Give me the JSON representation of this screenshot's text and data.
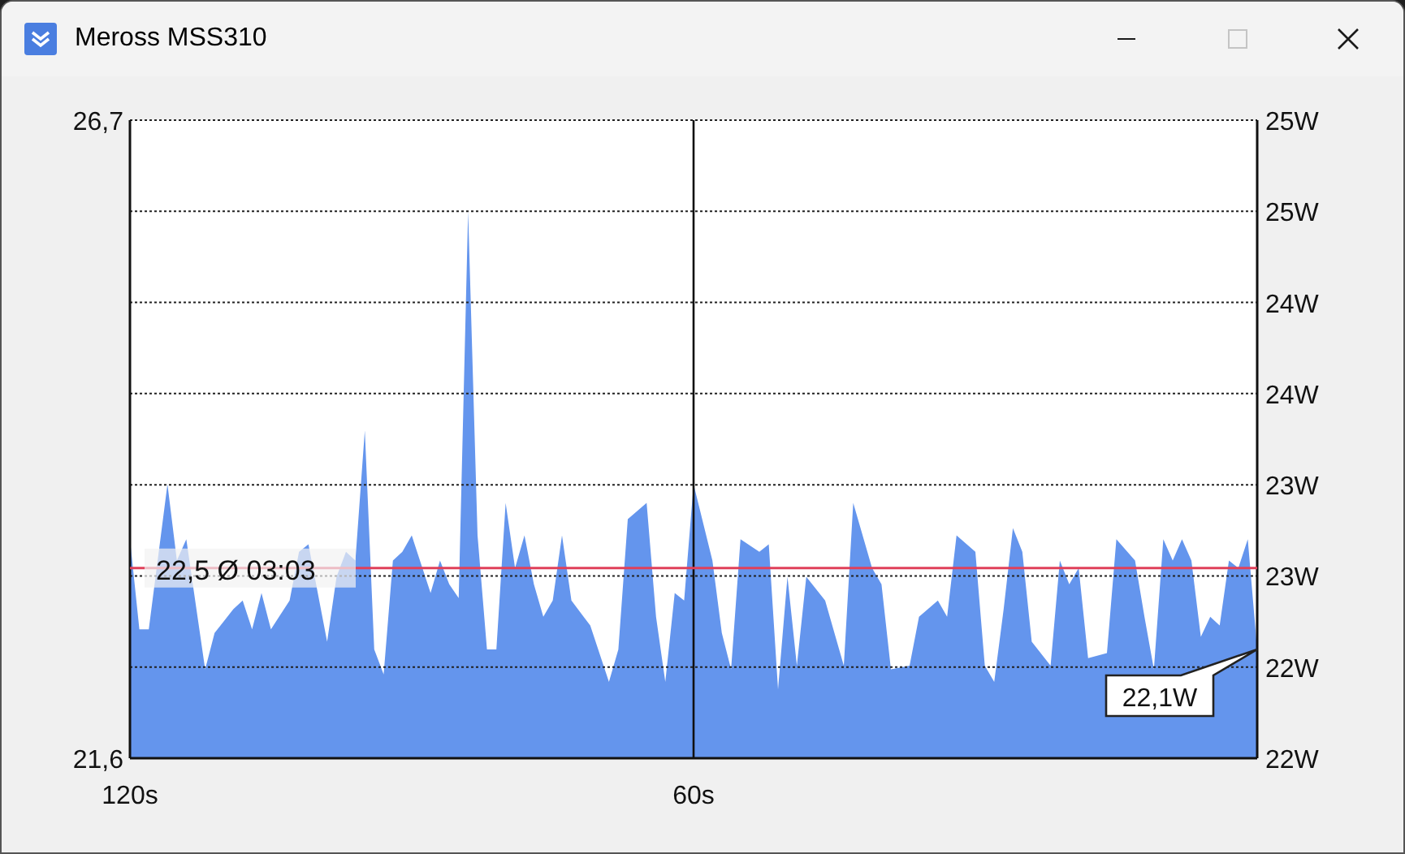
{
  "window": {
    "title": "Meross MSS310",
    "controls": [
      {
        "kind": "minimize",
        "disabled": false
      },
      {
        "kind": "maximize",
        "disabled": true
      },
      {
        "kind": "close",
        "disabled": false
      }
    ]
  },
  "chart": {
    "right_axis_labels": [
      "25W",
      "25W",
      "24W",
      "24W",
      "23W",
      "23W",
      "22W",
      "22W"
    ],
    "chart_data": {
      "type": "area",
      "xlim": [
        120,
        0
      ],
      "ylim": [
        21.6,
        26.7
      ],
      "xticks": [
        {
          "value": 120,
          "label": "120s"
        },
        {
          "value": 60,
          "label": "60s"
        }
      ],
      "yticks": [
        {
          "value": 26.7,
          "label": "26,7"
        },
        {
          "value": 21.6,
          "label": "21,6"
        }
      ],
      "x": [
        120,
        119,
        118,
        116,
        115,
        114,
        112,
        111,
        109,
        108,
        107,
        106,
        105,
        103,
        102,
        101,
        99,
        98,
        97,
        96,
        95,
        94,
        93,
        92,
        91,
        90,
        88,
        87,
        86,
        85,
        84,
        83,
        82,
        81,
        80,
        79,
        78,
        77,
        76,
        75,
        74,
        73,
        71,
        69,
        68,
        67,
        65,
        64,
        63,
        62,
        61,
        60,
        58,
        57,
        56,
        55,
        53,
        52,
        51,
        50,
        49,
        48,
        46,
        44,
        43,
        41,
        40,
        39,
        37,
        36,
        34,
        33,
        32,
        30,
        29,
        28,
        27,
        26,
        25,
        24,
        22,
        21,
        20,
        19,
        18,
        16,
        15,
        13,
        12,
        11,
        10,
        9,
        8,
        7,
        6,
        5,
        4,
        3,
        2,
        1,
        0
      ],
      "series": [
        {
          "color": "#6495ed",
          "values": [
            23.35,
            22.63,
            22.63,
            23.79,
            23.18,
            23.35,
            22.31,
            22.6,
            22.79,
            22.86,
            22.63,
            22.92,
            22.63,
            22.86,
            23.25,
            23.31,
            22.53,
            23.05,
            23.25,
            23.18,
            24.22,
            22.47,
            22.27,
            23.18,
            23.25,
            23.38,
            22.92,
            23.18,
            22.99,
            22.88,
            25.97,
            23.38,
            22.47,
            22.47,
            23.64,
            23.12,
            23.38,
            22.99,
            22.73,
            22.86,
            23.38,
            22.86,
            22.66,
            22.21,
            22.47,
            23.51,
            23.64,
            22.73,
            22.21,
            22.92,
            22.86,
            23.79,
            23.18,
            22.6,
            22.31,
            23.35,
            23.25,
            23.31,
            22.15,
            23.05,
            22.34,
            23.05,
            22.86,
            22.34,
            23.64,
            23.12,
            22.99,
            22.31,
            22.34,
            22.73,
            22.86,
            22.73,
            23.38,
            23.25,
            22.34,
            22.21,
            22.79,
            23.44,
            23.25,
            22.53,
            22.34,
            23.18,
            22.99,
            23.12,
            22.4,
            22.44,
            23.35,
            23.18,
            22.73,
            22.31,
            23.35,
            23.18,
            23.35,
            23.18,
            22.57,
            22.73,
            22.66,
            23.18,
            23.12,
            23.35,
            22.47
          ]
        }
      ],
      "ref_lines": [
        {
          "axis": "y",
          "value": 23.12,
          "color": "#e0405a"
        }
      ],
      "annotations": [
        {
          "text": "22,5 Ø 03:03",
          "x": 120,
          "y": 23.12
        },
        {
          "text": "22,1W",
          "x": 0,
          "y": 22.47
        }
      ]
    }
  }
}
